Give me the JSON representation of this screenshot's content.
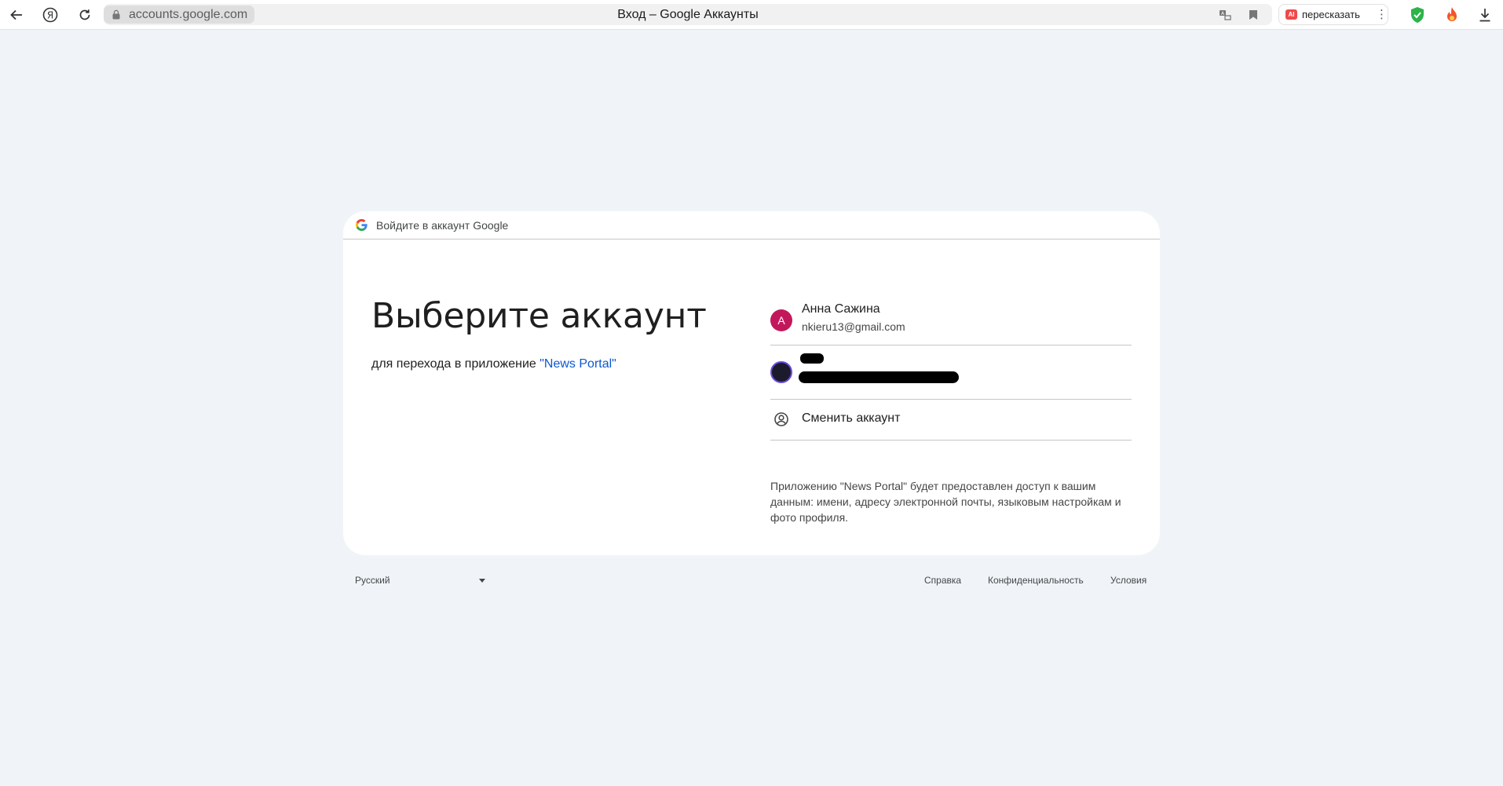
{
  "browser": {
    "url_domain": "accounts.google.com",
    "page_title": "Вход – Google Аккаунты",
    "retell_label": "пересказать",
    "retell_badge": "AI",
    "icons": [
      "back-arrow-icon",
      "yandex-icon",
      "reload-icon",
      "lock-icon",
      "translate-icon",
      "bookmark-icon",
      "more-icon",
      "shield-check-icon",
      "fire-icon",
      "download-icon"
    ]
  },
  "card": {
    "header_text": "Войдите в аккаунт Google",
    "heading": "Выберите аккаунт",
    "subtitle_prefix": "для перехода в приложение ",
    "app_name": "\"News Portal\"",
    "accounts": [
      {
        "avatar_letter": "A",
        "avatar_color": "#c2185b",
        "name": "Анна Сажина",
        "email": "nkieru13@gmail.com"
      }
    ],
    "switch_account_label": "Сменить аккаунт",
    "consent_text": "Приложению \"News Portal\" будет предоставлен доступ к вашим данным: имени, адресу электронной почты, языковым настройкам и фото профиля."
  },
  "footer": {
    "language": "Русский",
    "links": [
      "Справка",
      "Конфиденциальность",
      "Условия"
    ]
  },
  "colors": {
    "page_background": "#f0f4f9",
    "link_blue": "#0b57d0",
    "divider": "#c4c7c5"
  }
}
